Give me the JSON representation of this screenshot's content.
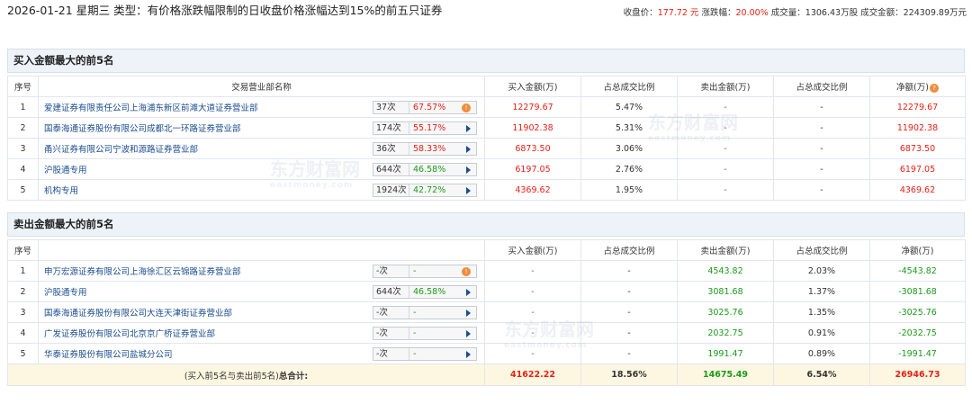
{
  "header": {
    "title": "2026-01-21 星期三 类型：有价格涨跌幅限制的日收盘价格涨幅达到15%的前五只证券",
    "close_label": "收盘价：",
    "close_value": "177.72 元",
    "change_label": "涨跌幅：",
    "change_value": "20.00%",
    "volume_label": "成交量：",
    "volume_value": "1306.43万股",
    "amount_label": "成交金额：",
    "amount_value": "224309.89万元"
  },
  "watermark": {
    "cn": "东方财富网",
    "en": "eastmoney.com"
  },
  "columns": [
    "序号",
    "交易营业部名称",
    "买入金额(万)",
    "占总成交比例",
    "卖出金额(万)",
    "占总成交比例",
    "净额(万)"
  ],
  "buy_section": {
    "title": "买入金额最大的前5名",
    "rows": [
      {
        "no": "1",
        "name": "爱建证券有限责任公司上海浦东新区前滩大道证券营业部",
        "count": "37次",
        "pct": "67.57%",
        "pct_color": "red",
        "marker": "hot",
        "buy": "12279.67",
        "buy_ratio": "5.47%",
        "sell": "-",
        "sell_ratio": "-",
        "net": "12279.67"
      },
      {
        "no": "2",
        "name": "国泰海通证券股份有限公司成都北一环路证券营业部",
        "count": "174次",
        "pct": "55.17%",
        "pct_color": "red",
        "marker": "arrow",
        "buy": "11902.38",
        "buy_ratio": "5.31%",
        "sell": "-",
        "sell_ratio": "-",
        "net": "11902.38"
      },
      {
        "no": "3",
        "name": "甬兴证券有限公司宁波和源路证券营业部",
        "count": "36次",
        "pct": "58.33%",
        "pct_color": "red",
        "marker": "arrow",
        "buy": "6873.50",
        "buy_ratio": "3.06%",
        "sell": "-",
        "sell_ratio": "-",
        "net": "6873.50"
      },
      {
        "no": "4",
        "name": "沪股通专用",
        "count": "644次",
        "pct": "46.58%",
        "pct_color": "green",
        "marker": "arrow",
        "buy": "6197.05",
        "buy_ratio": "2.76%",
        "sell": "-",
        "sell_ratio": "-",
        "net": "6197.05"
      },
      {
        "no": "5",
        "name": "机构专用",
        "count": "1924次",
        "pct": "42.72%",
        "pct_color": "green",
        "marker": "arrow",
        "buy": "4369.62",
        "buy_ratio": "1.95%",
        "sell": "-",
        "sell_ratio": "-",
        "net": "4369.62"
      }
    ]
  },
  "sell_section": {
    "title": "卖出金额最大的前5名",
    "rows": [
      {
        "no": "1",
        "name": "申万宏源证券有限公司上海徐汇区云锦路证券营业部",
        "count": "-次",
        "pct": "-",
        "pct_color": "green",
        "marker": "hot",
        "buy": "-",
        "buy_ratio": "-",
        "sell": "4543.82",
        "sell_ratio": "2.03%",
        "net": "-4543.82"
      },
      {
        "no": "2",
        "name": "沪股通专用",
        "count": "644次",
        "pct": "46.58%",
        "pct_color": "green",
        "marker": "arrow",
        "buy": "-",
        "buy_ratio": "-",
        "sell": "3081.68",
        "sell_ratio": "1.37%",
        "net": "-3081.68"
      },
      {
        "no": "3",
        "name": "国泰海通证券股份有限公司大连天津街证券营业部",
        "count": "-次",
        "pct": "-",
        "pct_color": "green",
        "marker": "arrow",
        "buy": "-",
        "buy_ratio": "-",
        "sell": "3025.76",
        "sell_ratio": "1.35%",
        "net": "-3025.76"
      },
      {
        "no": "4",
        "name": "广发证券股份有限公司北京京广桥证券营业部",
        "count": "-次",
        "pct": "-",
        "pct_color": "green",
        "marker": "arrow",
        "buy": "-",
        "buy_ratio": "-",
        "sell": "2032.75",
        "sell_ratio": "0.91%",
        "net": "-2032.75"
      },
      {
        "no": "5",
        "name": "华泰证券股份有限公司盐城分公司",
        "count": "-次",
        "pct": "-",
        "pct_color": "green",
        "marker": "arrow",
        "buy": "-",
        "buy_ratio": "-",
        "sell": "1991.47",
        "sell_ratio": "0.89%",
        "net": "-1991.47"
      }
    ]
  },
  "total": {
    "label_prefix": "(买入前5名与卖出前5名)",
    "label_strong": "总合计:",
    "buy": "41622.22",
    "buy_ratio": "18.56%",
    "sell": "14675.49",
    "sell_ratio": "6.54%",
    "net": "26946.73"
  },
  "colors": {
    "up": "#e62117",
    "down": "#1b9a1b",
    "link": "#1a4c8f",
    "header_bg": "#eef3f9",
    "total_bg": "#fdf7e2",
    "marker": "#f08c3a"
  }
}
